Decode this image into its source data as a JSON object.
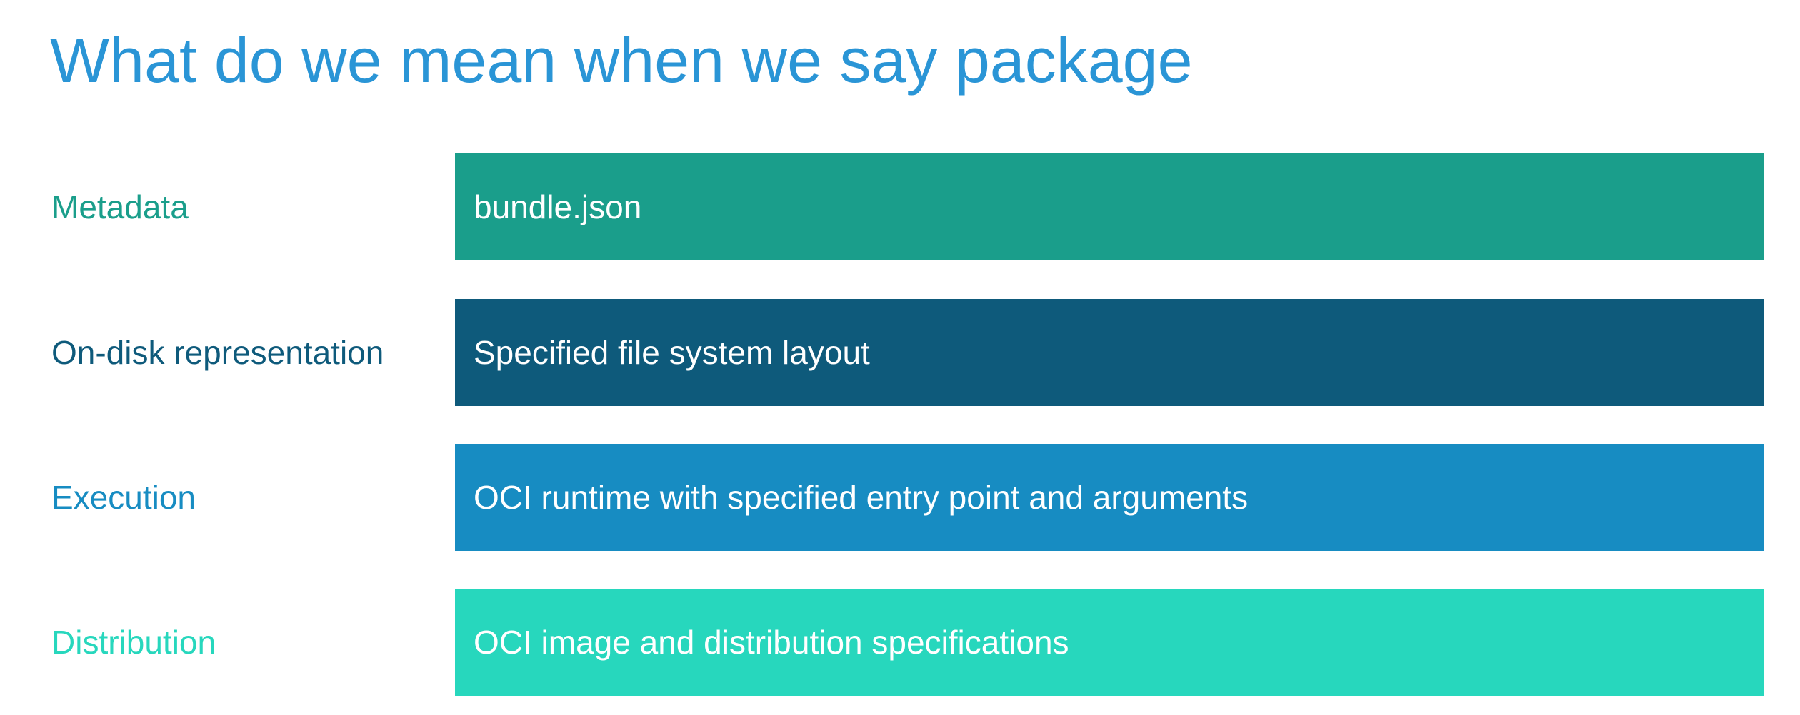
{
  "slide": {
    "title": "What do we mean when we say package",
    "title_color": "#2a95d6",
    "rows": [
      {
        "label": "Metadata",
        "label_color": "#1a9e8b",
        "bar_text": "bundle.json",
        "bar_color": "#1a9e8b"
      },
      {
        "label": "On-disk representation",
        "label_color": "#0e5a7b",
        "bar_text": "Specified file system layout",
        "bar_color": "#0e5a7b"
      },
      {
        "label": "Execution",
        "label_color": "#178cc2",
        "bar_text": "OCI runtime with specified entry point and arguments",
        "bar_color": "#178cc2"
      },
      {
        "label": "Distribution",
        "label_color": "#27d7bd",
        "bar_text": "OCI image and distribution specifications",
        "bar_color": "#27d7bd"
      }
    ]
  }
}
